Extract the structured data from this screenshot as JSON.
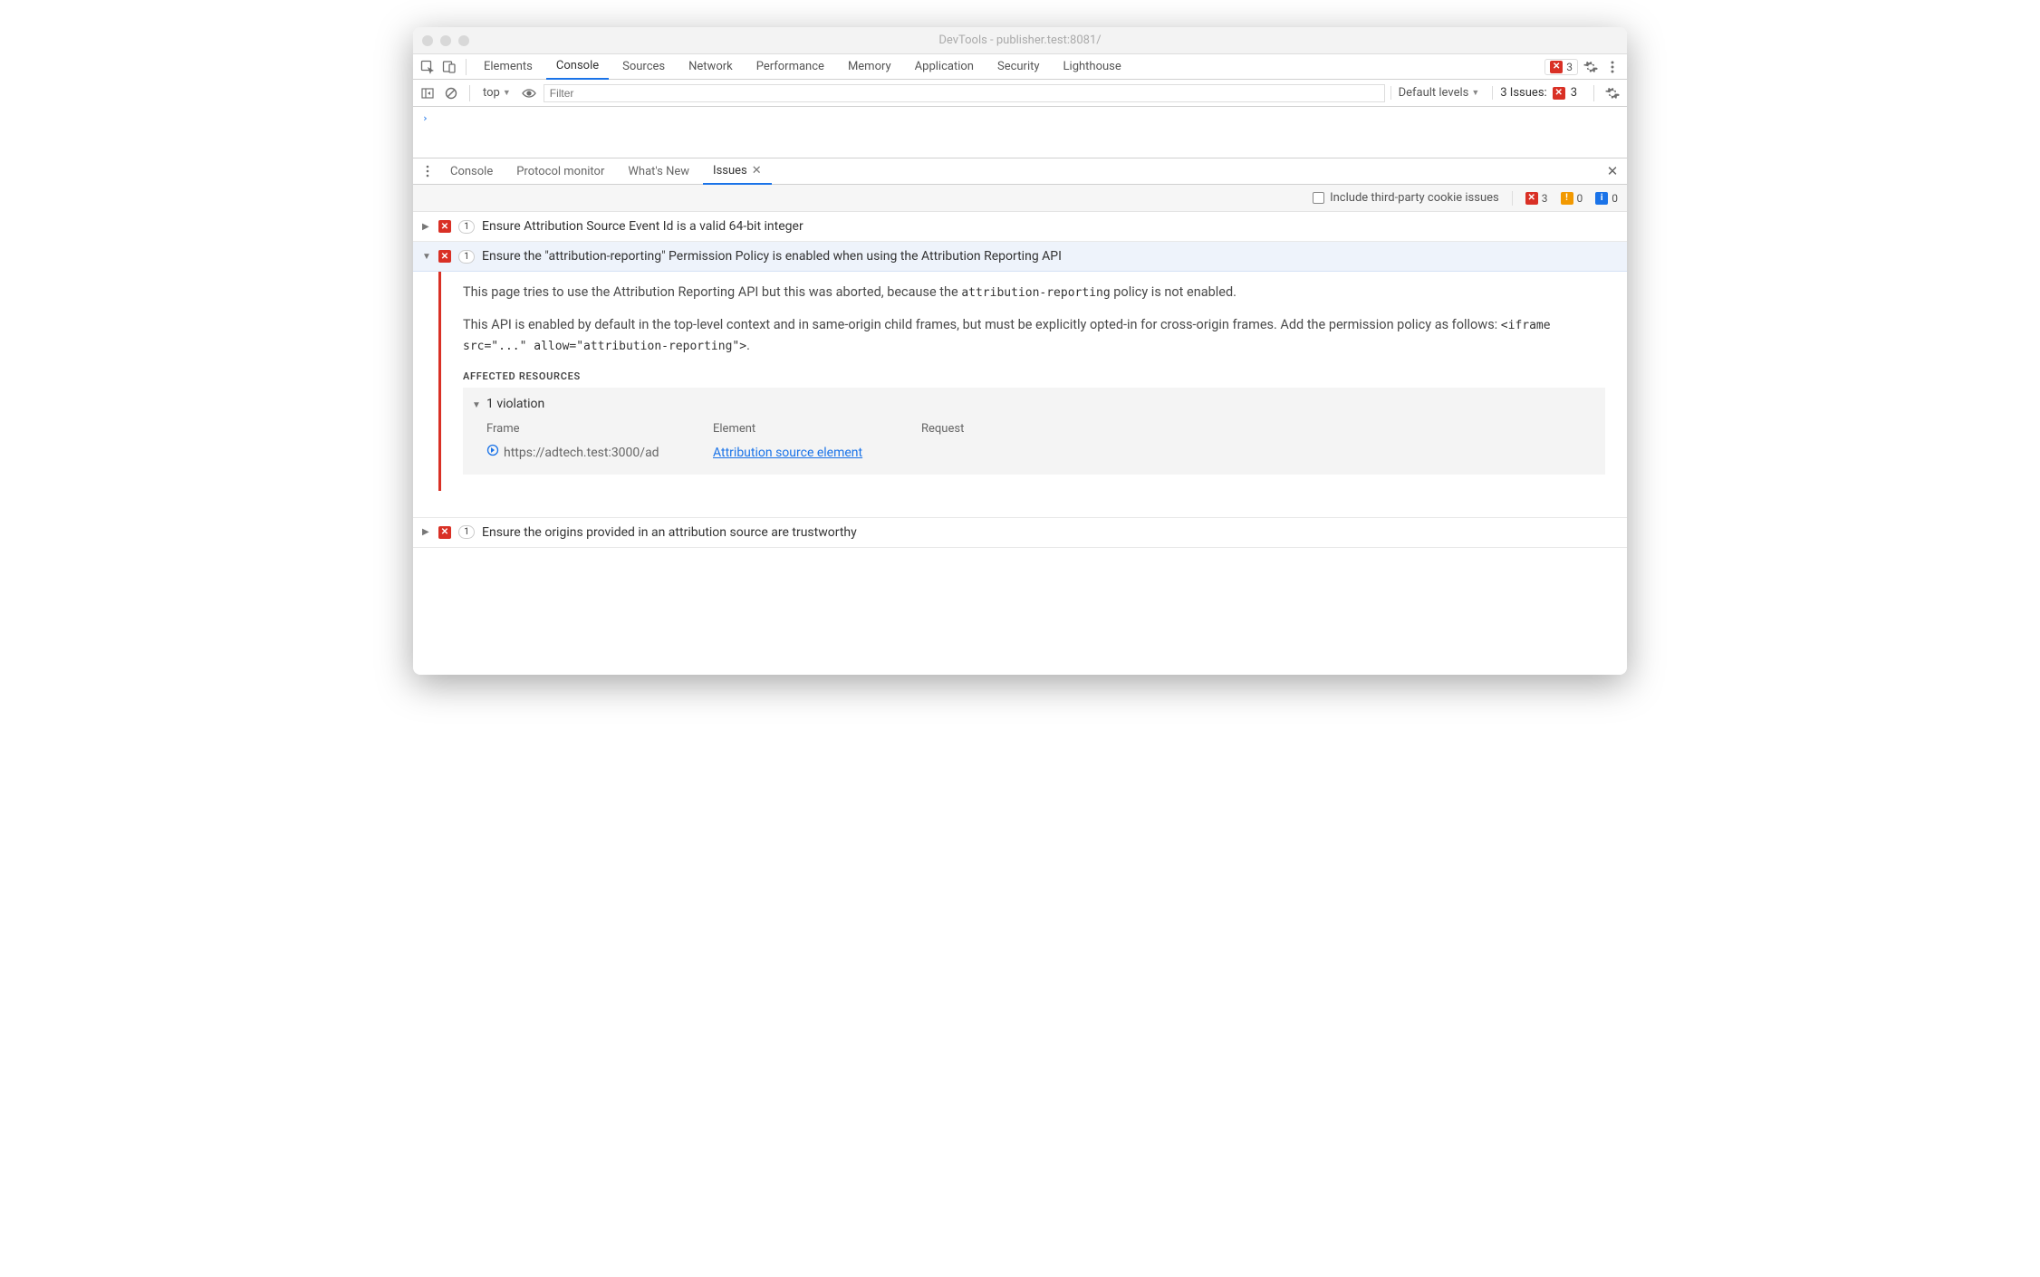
{
  "window": {
    "title": "DevTools - publisher.test:8081/"
  },
  "mainTabs": [
    "Elements",
    "Console",
    "Sources",
    "Network",
    "Performance",
    "Memory",
    "Application",
    "Security",
    "Lighthouse"
  ],
  "mainTabActiveIndex": 1,
  "topErrors": {
    "count": "3"
  },
  "consoleBar": {
    "context": "top",
    "filterPlaceholder": "Filter",
    "levels": "Default levels",
    "issuesLabel": "3 Issues:",
    "issuesErr": "3"
  },
  "consolePrompt": "›",
  "drawerTabs": [
    "Console",
    "Protocol monitor",
    "What's New",
    "Issues"
  ],
  "drawerTabActiveIndex": 3,
  "issuesBar": {
    "thirdPartyLabel": "Include third-party cookie issues",
    "err": "3",
    "warn": "0",
    "info": "0"
  },
  "issues": [
    {
      "expanded": false,
      "count": "1",
      "title": "Ensure Attribution Source Event Id is a valid 64-bit integer"
    },
    {
      "expanded": true,
      "count": "1",
      "title": "Ensure the \"attribution-reporting\" Permission Policy is enabled when using the Attribution Reporting API",
      "detail": {
        "p1_a": "This page tries to use the Attribution Reporting API but this was aborted, because the ",
        "p1_code": "attribution-reporting",
        "p1_b": " policy is not enabled.",
        "p2_a": "This API is enabled by default in the top-level context and in same-origin child frames, but must be explicitly opted-in for cross-origin frames. Add the permission policy as follows: ",
        "p2_code": "<iframe src=\"...\" allow=\"attribution-reporting\">",
        "p2_b": ".",
        "sectionHeader": "Affected Resources",
        "violationHeader": "1 violation",
        "columns": {
          "frame": "Frame",
          "element": "Element",
          "request": "Request"
        },
        "row": {
          "frame": "https://adtech.test:3000/ad",
          "element": "Attribution source element",
          "request": ""
        }
      }
    },
    {
      "expanded": false,
      "count": "1",
      "title": "Ensure the origins provided in an attribution source are trustworthy"
    }
  ]
}
